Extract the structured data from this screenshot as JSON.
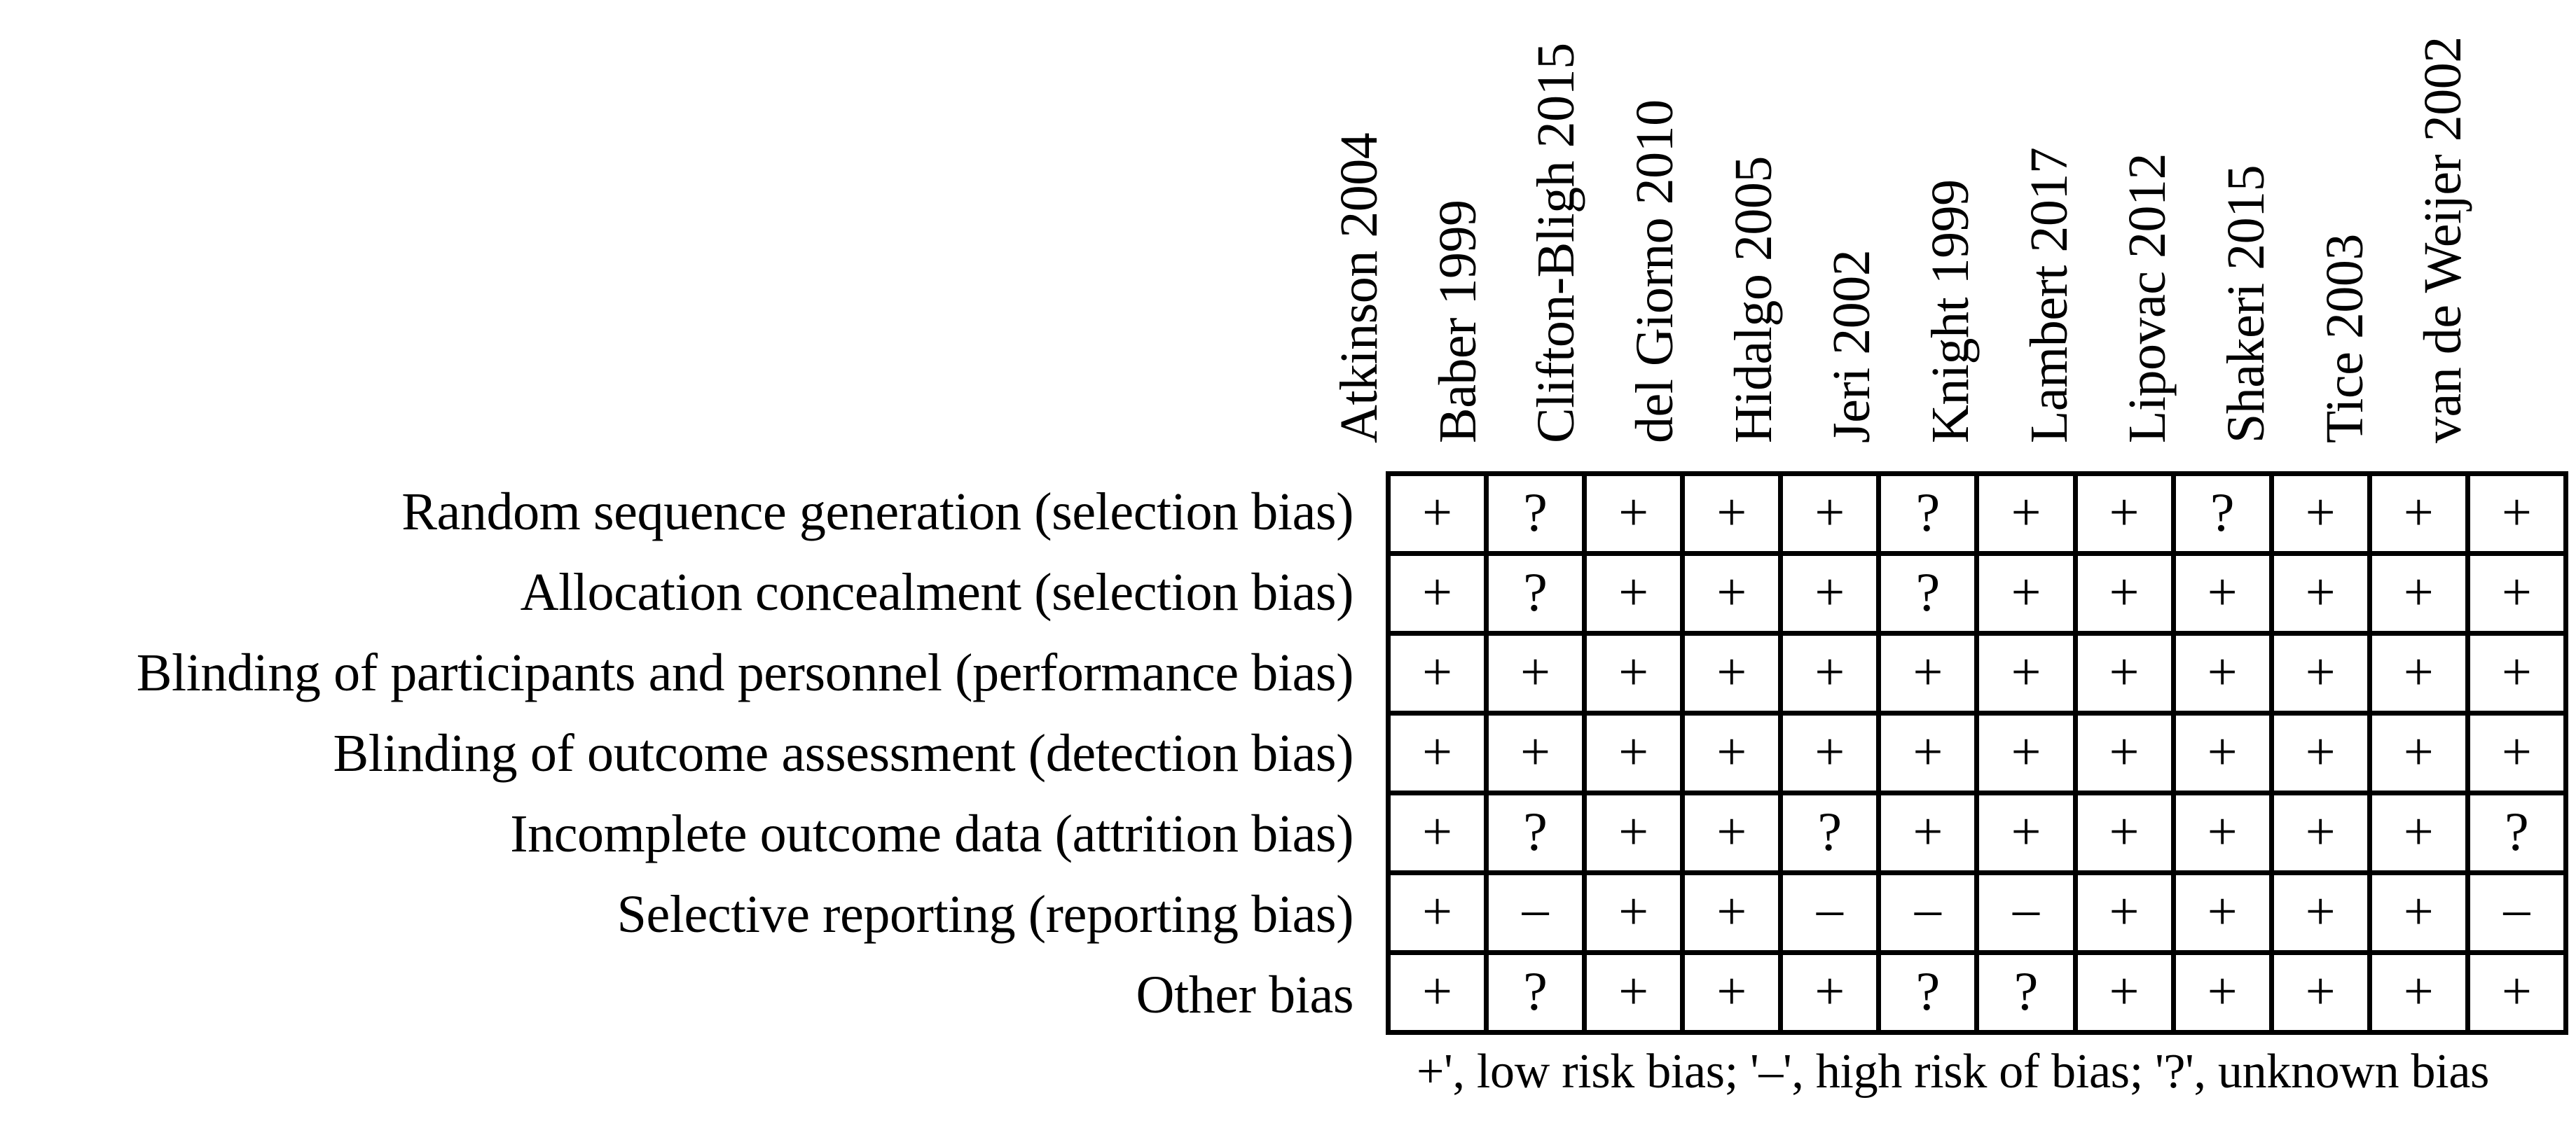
{
  "chart_data": {
    "type": "table",
    "title": "",
    "subtitle": "",
    "xlabel": "",
    "ylabel": "",
    "legend_position": "below",
    "grid": true,
    "categories": [
      "Atkinson 2004",
      "Baber 1999",
      "Clifton-Bligh 2015",
      "del Giorno 2010",
      "Hidalgo 2005",
      "Jeri 2002",
      "Knight 1999",
      "Lambert 2017",
      "Lipovac 2012",
      "Shakeri 2015",
      "Tice 2003",
      "van de Weijer 2002"
    ],
    "row_labels": [
      "Random sequence generation (selection bias)",
      "Allocation concealment (selection bias)",
      "Blinding of participants and personnel (performance bias)",
      "Blinding of outcome assessment (detection bias)",
      "Incomplete outcome data (attrition bias)",
      "Selective reporting (reporting bias)",
      "Other bias"
    ],
    "series": [
      {
        "name": "Random sequence generation (selection bias)",
        "values": [
          "+",
          "?",
          "+",
          "+",
          "+",
          "?",
          "+",
          "+",
          "?",
          "+",
          "+",
          "+"
        ]
      },
      {
        "name": "Allocation concealment (selection bias)",
        "values": [
          "+",
          "?",
          "+",
          "+",
          "+",
          "?",
          "+",
          "+",
          "+",
          "+",
          "+",
          "+"
        ]
      },
      {
        "name": "Blinding of participants and personnel (performance bias)",
        "values": [
          "+",
          "+",
          "+",
          "+",
          "+",
          "+",
          "+",
          "+",
          "+",
          "+",
          "+",
          "+"
        ]
      },
      {
        "name": "Blinding of outcome assessment (detection bias)",
        "values": [
          "+",
          "+",
          "+",
          "+",
          "+",
          "+",
          "+",
          "+",
          "+",
          "+",
          "+",
          "+"
        ]
      },
      {
        "name": "Incomplete outcome data (attrition bias)",
        "values": [
          "+",
          "?",
          "+",
          "+",
          "?",
          "+",
          "+",
          "+",
          "+",
          "+",
          "+",
          "?"
        ]
      },
      {
        "name": "Selective reporting (reporting bias)",
        "values": [
          "+",
          "–",
          "+",
          "+",
          "–",
          "–",
          "–",
          "+",
          "+",
          "+",
          "+",
          "–"
        ]
      },
      {
        "name": "Other bias",
        "values": [
          "+",
          "?",
          "+",
          "+",
          "+",
          "?",
          "?",
          "+",
          "+",
          "+",
          "+",
          "+"
        ]
      }
    ],
    "annotations": [
      "+', low risk bias; '–', high risk of bias; '?', unknown bias"
    ],
    "legend_entries": [
      {
        "symbol": "+",
        "meaning": "low risk bias"
      },
      {
        "symbol": "–",
        "meaning": "high risk of bias"
      },
      {
        "symbol": "?",
        "meaning": "unknown bias"
      }
    ]
  },
  "footnote": {
    "text": "+', low risk bias; '–', high risk of bias; '?', unknown bias"
  },
  "colors": {
    "grid_line": "#000000",
    "text": "#000000",
    "background": "#ffffff"
  }
}
